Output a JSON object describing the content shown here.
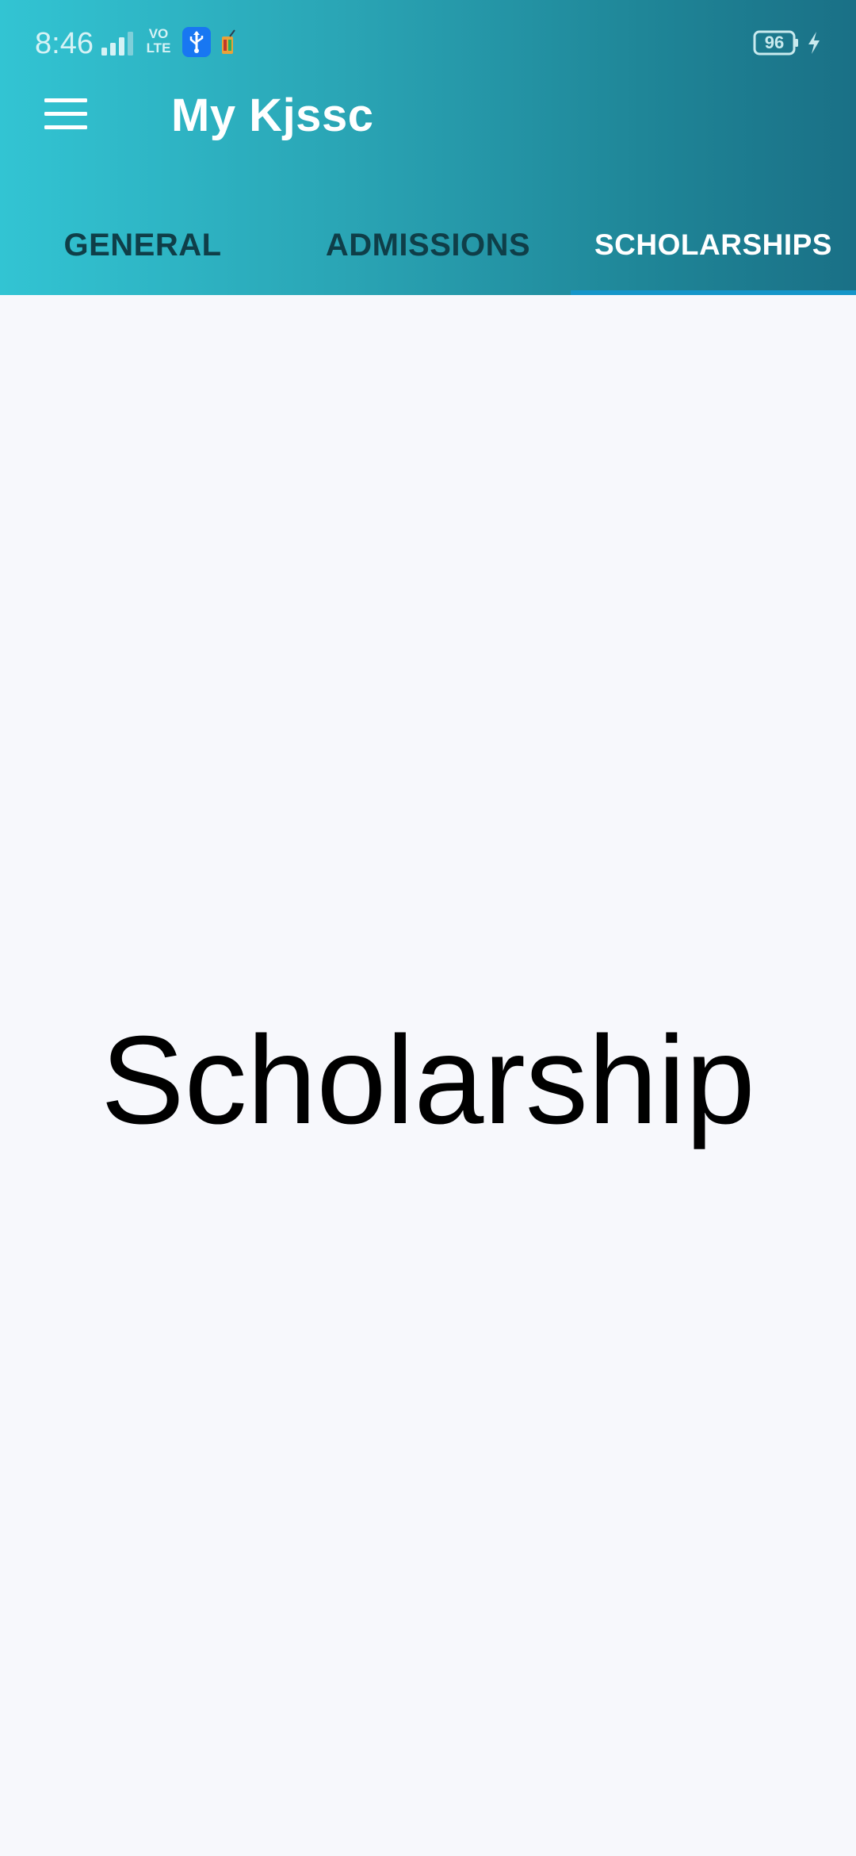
{
  "status_bar": {
    "time": "8:46",
    "network_badge": "VO\nLTE",
    "battery_level": "96",
    "icons": [
      "signal-icon",
      "volte-icon",
      "usb-icon",
      "app-notification-icon",
      "battery-icon",
      "charging-icon"
    ]
  },
  "toolbar": {
    "title": "My Kjssc",
    "menu_icon": "hamburger-menu-icon"
  },
  "tabs": [
    {
      "label": "GENERAL",
      "active": false
    },
    {
      "label": "ADMISSIONS",
      "active": false
    },
    {
      "label": "SCHOLARSHIPS",
      "active": true
    }
  ],
  "content": {
    "heading": "Scholarship"
  },
  "colors": {
    "header_gradient_start": "#32c4d3",
    "header_gradient_end": "#1a7086",
    "tab_indicator": "#1596c9",
    "inactive_tab_text": "#0f3e48",
    "active_tab_text": "#ffffff",
    "background": "#f7f8fc"
  }
}
